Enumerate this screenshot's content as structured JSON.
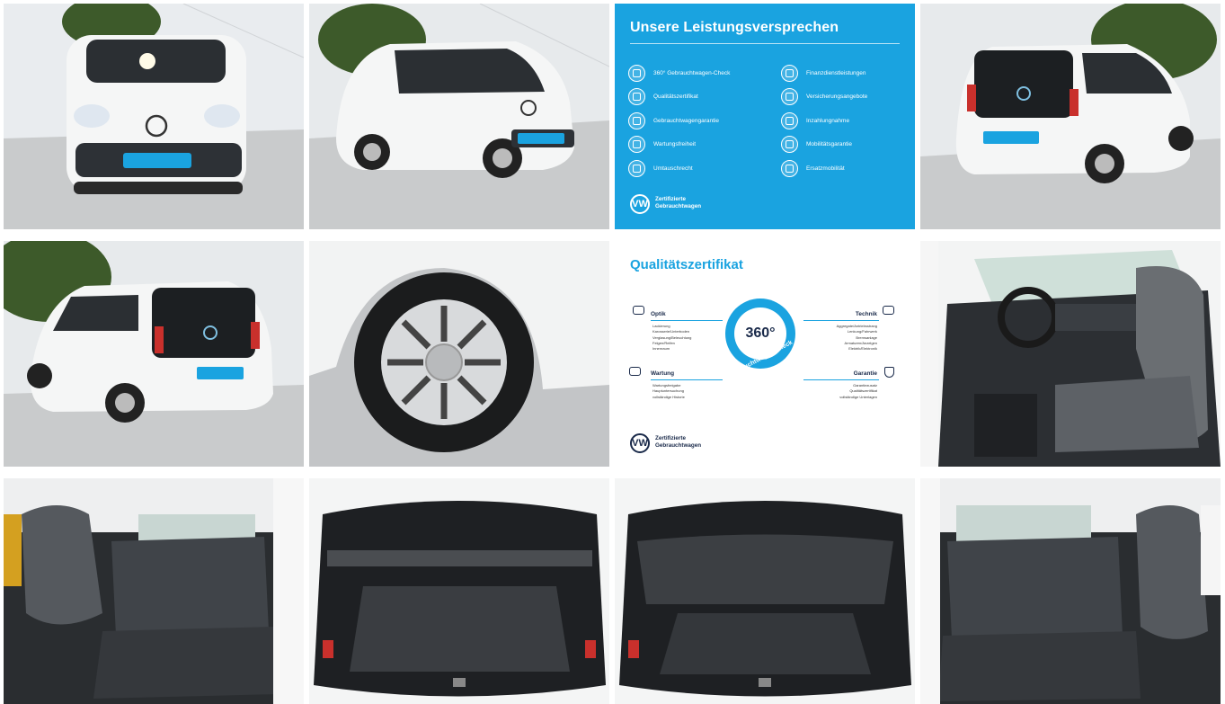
{
  "gallery": {
    "photos": [
      {
        "icon": "car-front-photo-icon"
      },
      {
        "icon": "car-front-three-quarter-photo-icon"
      },
      {
        "icon": "car-rear-three-quarter-photo-icon"
      },
      {
        "icon": "car-rear-left-photo-icon"
      },
      {
        "icon": "wheel-photo-icon"
      },
      {
        "icon": "cockpit-photo-icon"
      },
      {
        "icon": "rear-seats-photo-icon"
      },
      {
        "icon": "trunk-open-photo-icon"
      },
      {
        "icon": "trunk-cover-photo-icon"
      },
      {
        "icon": "rear-seats-right-photo-icon"
      }
    ]
  },
  "promise": {
    "title": "Unsere Leistungsversprechen",
    "left_items": [
      "360° Gebrauchtwagen-Check",
      "Qualitätszertifikat",
      "Gebrauchtwagengarantie",
      "Wartungsfreiheit",
      "Umtauschrecht"
    ],
    "right_items": [
      "Finanzdienstleistungen",
      "Versicherungsangebote",
      "Inzahlungnahme",
      "Mobilitätsgarantie",
      "Ersatzmobilität"
    ],
    "brand_line1": "Zertifizierte",
    "brand_line2": "Gebrauchtwagen",
    "logo": "VW",
    "color": "#1aa3e0"
  },
  "quality": {
    "title": "Qualitätszertifikat",
    "center_label": "360°",
    "ring_label": "Gebrauchtwagen-Check",
    "sections": {
      "optik": {
        "title": "Optik",
        "items": [
          "Lackierung",
          "Karosserie/Unterboden",
          "Verglasung/Beleuchtung",
          "Felgen/Reifen",
          "Innenraum"
        ]
      },
      "technik": {
        "title": "Technik",
        "items": [
          "Aggregate/Antriebsstrang",
          "Lenkung/Fahrwerk",
          "Bremsanlage",
          "Armaturen/Anzeigen",
          "Elektrik/Elektronik"
        ]
      },
      "wartung": {
        "title": "Wartung",
        "items": [
          "Wartungsfreigabe",
          "Hauptuntersuchung",
          "vollständige Historie"
        ]
      },
      "garantie": {
        "title": "Garantie",
        "items": [
          "Garantiezusatz",
          "Qualitätszertifikat",
          "vollständige Unterlagen"
        ]
      }
    },
    "brand_line1": "Zertifizierte",
    "brand_line2": "Gebrauchtwagen",
    "logo": "VW",
    "accent": "#1aa3e0"
  }
}
